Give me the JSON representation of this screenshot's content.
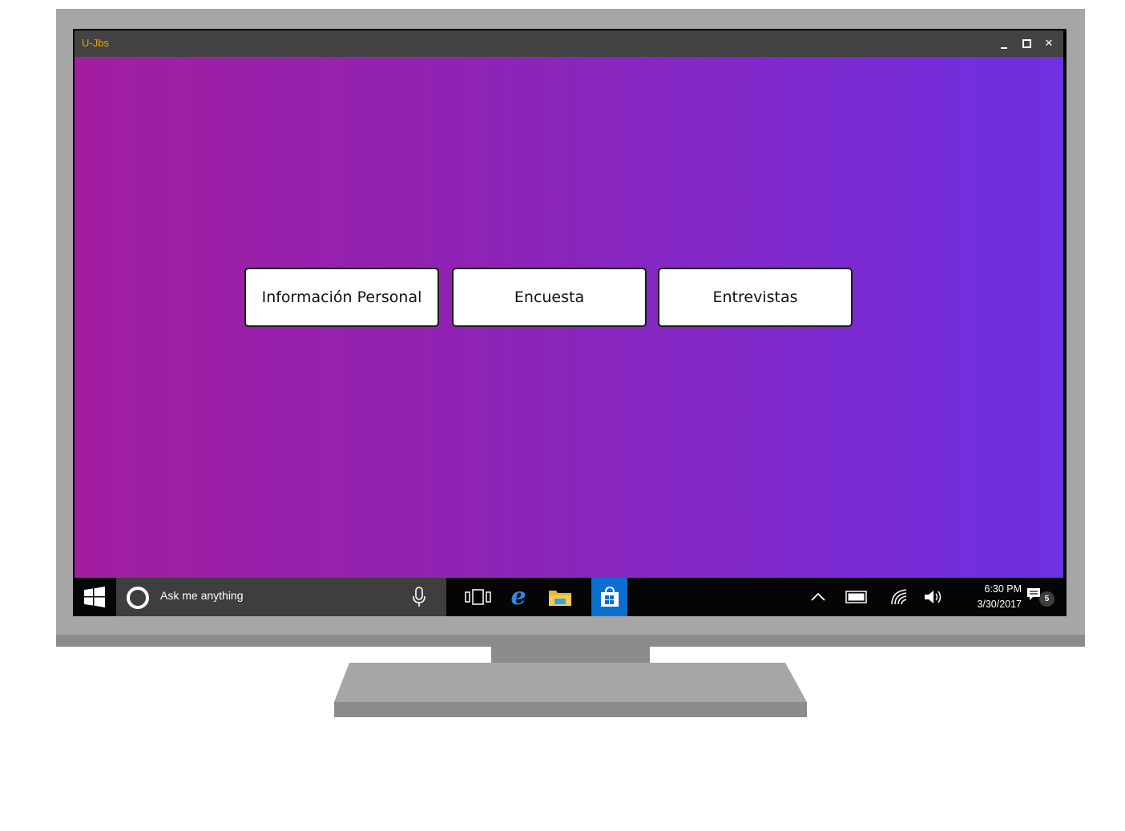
{
  "window": {
    "title": "U-Jbs",
    "title_color": "#f0a000",
    "controls": [
      "minimize-icon",
      "maximize-icon",
      "close-icon"
    ],
    "close_glyph": "✕"
  },
  "content": {
    "background_gradient": [
      "#a21e9f",
      "#6d30e2"
    ],
    "buttons": [
      {
        "label": "Información Personal"
      },
      {
        "label": "Encuesta"
      },
      {
        "label": "Entrevistas"
      }
    ]
  },
  "taskbar": {
    "search_placeholder": "Ask me anything",
    "pinned": [
      "task-view-icon",
      "edge-icon",
      "file-explorer-icon",
      "store-icon"
    ],
    "tray": [
      "chevron-up-icon",
      "battery-icon",
      "wifi-icon",
      "volume-icon"
    ],
    "clock": {
      "time": "6:30 PM",
      "date": "3/30/2017"
    },
    "notifications": {
      "count": "5"
    },
    "accent_color": "#0a6fd0"
  }
}
